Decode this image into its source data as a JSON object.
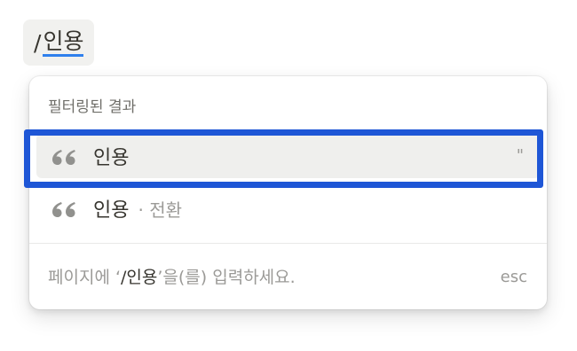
{
  "command": {
    "slash": "/",
    "query": "인용"
  },
  "menu": {
    "header": "필터링된 결과",
    "items": [
      {
        "icon": "quote-icon",
        "label": "인용",
        "sub": "",
        "shortcut": "\""
      },
      {
        "icon": "quote-icon",
        "label": "인용",
        "sub": "· 전환",
        "shortcut": ""
      }
    ],
    "footer": {
      "prefix": "페이지에 ‘",
      "command": "/인용",
      "suffix": "’을(를) 입력하세요.",
      "esc": "esc"
    }
  },
  "colors": {
    "annotation": "#1e56d6",
    "accent": "#2f80ed"
  }
}
